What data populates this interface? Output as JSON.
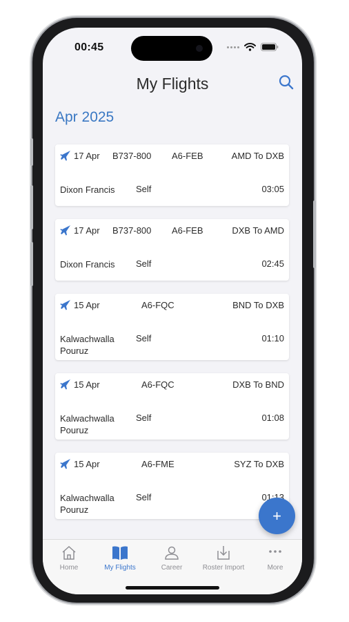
{
  "status_bar": {
    "time": "00:45"
  },
  "nav": {
    "title": "My Flights"
  },
  "section": {
    "header": "Apr 2025"
  },
  "flights": [
    {
      "date": "17 Apr",
      "aircraft": "B737-800",
      "registration": "A6-FEB",
      "route": "AMD To DXB",
      "pilot": "Dixon Francis",
      "role": "Self",
      "duration": "03:05"
    },
    {
      "date": "17 Apr",
      "aircraft": "B737-800",
      "registration": "A6-FEB",
      "route": "DXB To AMD",
      "pilot": "Dixon Francis",
      "role": "Self",
      "duration": "02:45"
    },
    {
      "date": "15 Apr",
      "aircraft": "",
      "registration": "A6-FQC",
      "route": "BND To DXB",
      "pilot": "Kalwachwalla Pouruz",
      "role": "Self",
      "duration": "01:10"
    },
    {
      "date": "15 Apr",
      "aircraft": "",
      "registration": "A6-FQC",
      "route": "DXB To BND",
      "pilot": "Kalwachwalla Pouruz",
      "role": "Self",
      "duration": "01:08"
    },
    {
      "date": "15 Apr",
      "aircraft": "",
      "registration": "A6-FME",
      "route": "SYZ To DXB",
      "pilot": "Kalwachwalla Pouruz",
      "role": "Self",
      "duration": "01:13"
    }
  ],
  "fab": {
    "label": "+"
  },
  "tabs": [
    {
      "label": "Home",
      "icon": "home-icon",
      "active": false
    },
    {
      "label": "My Flights",
      "icon": "book-icon",
      "active": true
    },
    {
      "label": "Career",
      "icon": "person-icon",
      "active": false
    },
    {
      "label": "Roster Import",
      "icon": "import-icon",
      "active": false
    },
    {
      "label": "More",
      "icon": "more-icon",
      "active": false
    }
  ],
  "colors": {
    "accent": "#3b76cc",
    "header": "#3a78c3",
    "background": "#f3f3f7",
    "inactive": "#8e8e93"
  }
}
